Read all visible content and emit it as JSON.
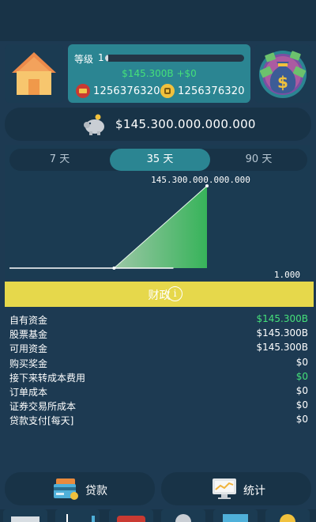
{
  "level": {
    "label": "等级",
    "value": "1",
    "progress": 0.02
  },
  "income": "$145.300B +$0",
  "currencies": [
    {
      "icon": "red-chest-coin-icon",
      "value": "1256376320"
    },
    {
      "icon": "gold-coin-icon",
      "value": "1256376320"
    }
  ],
  "balance": "$145.300.000.000.000",
  "tabs": [
    {
      "label": "7 天"
    },
    {
      "label": "35 天",
      "active": true
    },
    {
      "label": "90 天"
    }
  ],
  "chart_data": {
    "type": "area",
    "x": [
      0,
      1,
      2,
      3,
      4,
      5,
      6,
      7,
      8,
      9,
      10,
      11,
      12,
      13,
      14,
      15,
      16,
      17,
      18,
      19,
      20,
      21,
      22,
      23,
      24,
      25,
      26,
      27,
      28,
      29,
      30,
      31,
      32,
      33,
      34
    ],
    "y": [
      1000,
      1000,
      1000,
      1000,
      1000,
      1000,
      1000,
      1000,
      1000,
      1000,
      1000,
      1000,
      1000,
      1000,
      1000,
      1000,
      1000,
      1000,
      1000,
      1000,
      1000,
      1000,
      1000,
      1000,
      1000,
      1000,
      1000,
      1000,
      1000,
      1000,
      1000,
      1000,
      1000,
      1000,
      145300000000000
    ],
    "max_label": "145.300.000.000.000",
    "min_label": "1.000",
    "colors": {
      "fill": "#37b35a",
      "line": "#ffffff"
    }
  },
  "finance": {
    "label": "财政"
  },
  "rows": [
    {
      "key": "自有资金",
      "value": "$145.300B",
      "color": "green"
    },
    {
      "key": "股票基金",
      "value": "$145.300B",
      "color": "white"
    },
    {
      "key": "可用资金",
      "value": "$145.300B",
      "color": "white"
    },
    {
      "key": "购买奖金",
      "value": "$0",
      "color": "white"
    },
    {
      "key": "接下来转成本费用",
      "value": "$0",
      "color": "green"
    },
    {
      "key": "订单成本",
      "value": "$0",
      "color": "white"
    },
    {
      "key": "证券交易所成本",
      "value": "$0",
      "color": "white"
    },
    {
      "key": "贷款支付[每天]",
      "value": "$0",
      "color": "white"
    }
  ],
  "buttons": {
    "loan": "贷款",
    "stats": "统计"
  },
  "colors": {
    "background": "#1d3a52",
    "accent": "#2b8592",
    "finance_bar": "#e6d84b",
    "green": "#45e07a"
  }
}
